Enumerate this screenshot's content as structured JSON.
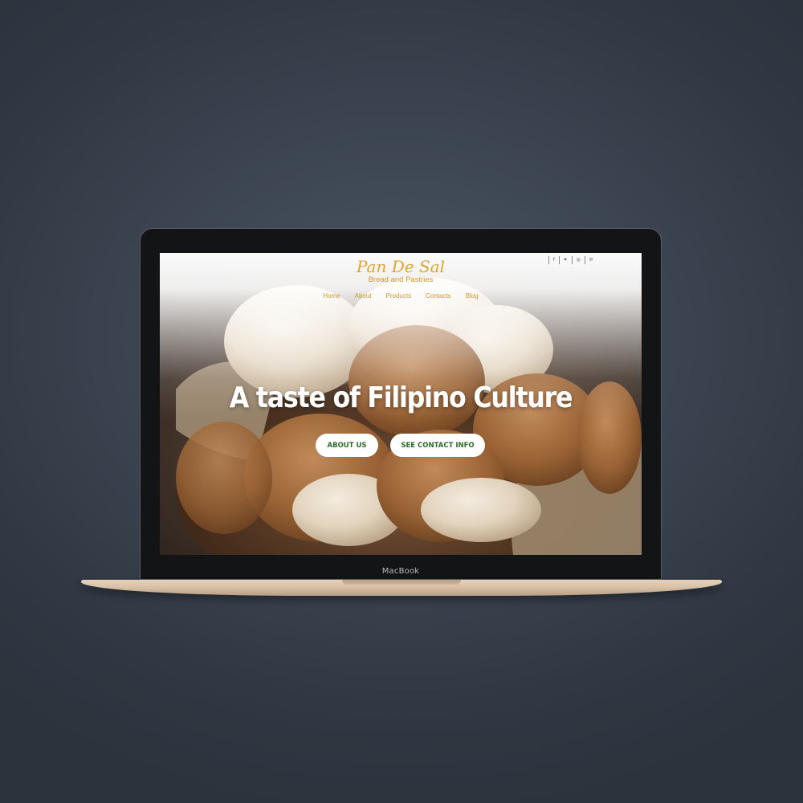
{
  "device": {
    "brand": "MacBook"
  },
  "website": {
    "logo": {
      "title": "Pan De Sal",
      "subtitle": "Bread and Pastries"
    },
    "social_icons": [
      "facebook-icon",
      "twitter-icon",
      "instagram-icon",
      "pinterest-icon"
    ],
    "social_glyphs": [
      "f",
      "✦",
      "◎",
      "℗"
    ],
    "nav": [
      {
        "label": "Home"
      },
      {
        "label": "About"
      },
      {
        "label": "Products"
      },
      {
        "label": "Contacts"
      },
      {
        "label": "Blog"
      }
    ],
    "hero": {
      "headline": "A taste of Filipino Culture",
      "buttons": {
        "about": "ABOUT US",
        "contact": "SEE CONTACT INFO"
      }
    }
  },
  "colors": {
    "accent_gold": "#e0a52e",
    "button_text_green": "#2f6b2a",
    "background": "#3b4450"
  }
}
